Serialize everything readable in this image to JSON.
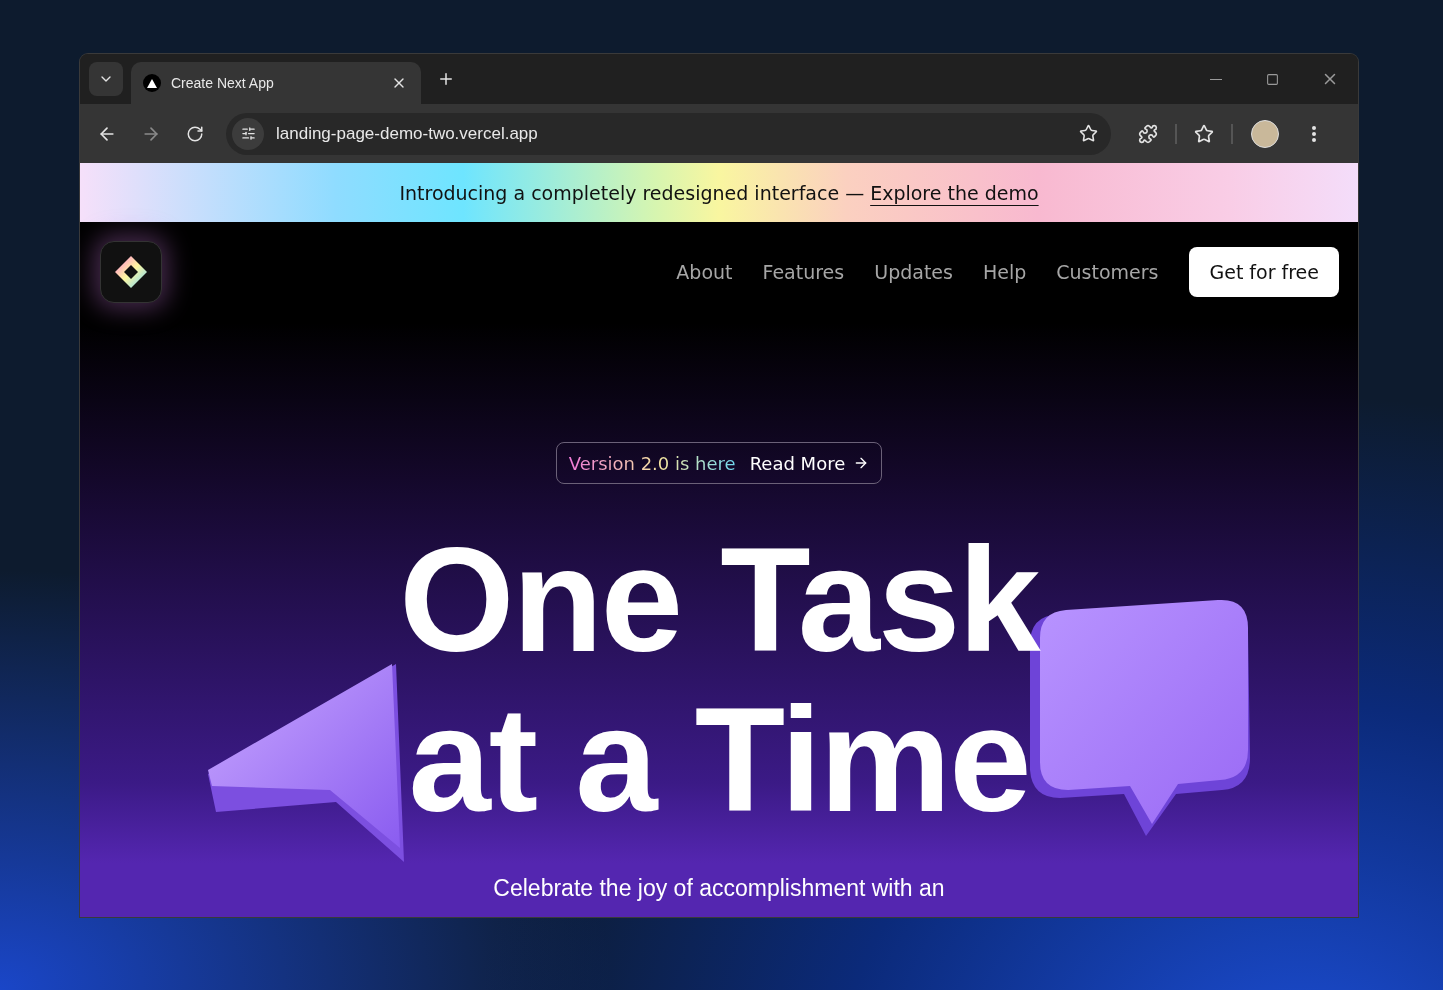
{
  "browser": {
    "tabs": [
      {
        "title": "Create Next App",
        "selected": true
      }
    ],
    "address": "landing-page-demo-two.vercel.app"
  },
  "banner": {
    "text": "Introducing a completely redesigned interface —",
    "link": "Explore the demo"
  },
  "nav": {
    "links": [
      "About",
      "Features",
      "Updates",
      "Help",
      "Customers"
    ],
    "cta": "Get for free"
  },
  "hero": {
    "pill": {
      "text": "Version 2.0 is here",
      "link": "Read More"
    },
    "headline": [
      "One Task",
      "at a Time"
    ],
    "subtitle": "Celebrate the joy of accomplishment with an"
  }
}
